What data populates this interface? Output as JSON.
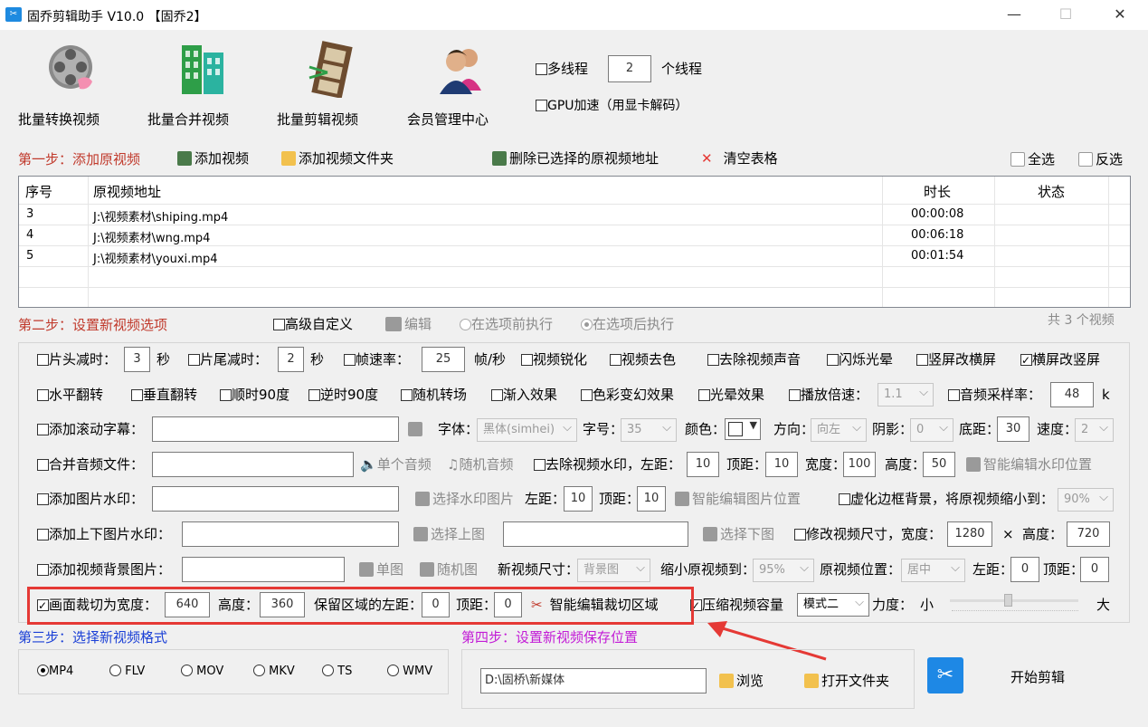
{
  "window": {
    "title": "固乔剪辑助手 V10.0 【固乔2】",
    "min_glyph": "—",
    "max_glyph": "☐",
    "close_glyph": "✕"
  },
  "toolbar": {
    "batch_convert": "批量转换视频",
    "batch_merge": "批量合并视频",
    "batch_edit": "批量剪辑视频",
    "member_center": "会员管理中心",
    "multithread_label": "多线程",
    "threads_value": "2",
    "threads_unit": "个线程",
    "gpu_label": "GPU加速（用显卡解码）"
  },
  "step1": {
    "label": "第一步：添加原视频",
    "add_video": "添加视频",
    "add_folder": "添加视频文件夹",
    "delete_selected": "删除已选择的原视频地址",
    "clear_table": "清空表格",
    "select_all": "全选",
    "invert": "反选"
  },
  "table": {
    "headers": [
      "序号",
      "原视频地址",
      "时长",
      "状态"
    ],
    "rows": [
      {
        "no": "3",
        "path": "J:\\视频素材\\shiping.mp4",
        "duration": "00:00:08",
        "status": ""
      },
      {
        "no": "4",
        "path": "J:\\视频素材\\wng.mp4",
        "duration": "00:06:18",
        "status": ""
      },
      {
        "no": "5",
        "path": "J:\\视频素材\\youxi.mp4",
        "duration": "00:01:54",
        "status": ""
      }
    ]
  },
  "step2": {
    "label": "第二步：设置新视频选项",
    "advanced": "高级自定义",
    "edit": "编辑",
    "before": "在选项前执行",
    "after": "在选项后执行",
    "total": "共 3 个视频"
  },
  "opts": {
    "r1": {
      "head_cut": "片头减时：",
      "head_val": "3",
      "sec1": "秒",
      "tail_cut": "片尾减时：",
      "tail_val": "2",
      "sec2": "秒",
      "fps": "帧速率：",
      "fps_val": "25",
      "fps_unit": "帧/秒",
      "sharpen": "视频锐化",
      "decolor": "视频去色",
      "mute": "去除视频声音",
      "flash": "闪烁光晕",
      "v2h": "竖屏改横屏",
      "h2v": "横屏改竖屏"
    },
    "r2": {
      "hflip": "水平翻转",
      "vflip": "垂直翻转",
      "cw90": "顺时90度",
      "ccw90": "逆时90度",
      "random_trans": "随机转场",
      "fade": "渐入效果",
      "color_fx": "色彩变幻效果",
      "halo": "光晕效果",
      "speed": "播放倍速：",
      "speed_val": "1.1",
      "sample": "音频采样率：",
      "sample_val": "48",
      "sample_unit": "k"
    },
    "r3": {
      "scroll": "添加滚动字幕：",
      "font": "字体：",
      "font_val": "黑体(simhei)",
      "size": "字号：",
      "size_val": "35",
      "color": "颜色：",
      "dir": "方向：",
      "dir_val": "向左",
      "shadow": "阴影：",
      "shadow_val": "0",
      "bottom": "底距：",
      "bottom_val": "30",
      "spd": "速度：",
      "spd_val": "2"
    },
    "r4": {
      "merge_audio": "合并音频文件：",
      "single_audio": "单个音频",
      "random_audio": "随机音频",
      "remove_wm": "去除视频水印，左距：",
      "left_val": "10",
      "top": "顶距：",
      "top_val": "10",
      "width": "宽度：",
      "width_val": "100",
      "height": "高度：",
      "height_val": "50",
      "smart_wm": "智能编辑水印位置"
    },
    "r5": {
      "img_wm": "添加图片水印：",
      "select_wm": "选择水印图片",
      "left": "左距：",
      "left_val": "10",
      "top": "顶距：",
      "top_val": "10",
      "smart_img": "智能编辑图片位置",
      "blur_bg": "虚化边框背景，将原视频缩小到：",
      "blur_val": "90%"
    },
    "r6": {
      "tb_wm": "添加上下图片水印：",
      "select_top": "选择上图",
      "select_bottom": "选择下图",
      "resize": "修改视频尺寸，宽度：",
      "resize_w": "1280",
      "times": "×",
      "resize_h_label": "高度：",
      "resize_h": "720"
    },
    "r7": {
      "bg_img": "添加视频背景图片：",
      "single": "单图",
      "random": "随机图",
      "new_size": "新视频尺寸：",
      "new_size_val": "背景图",
      "shrink": "缩小原视频到：",
      "shrink_val": "95%",
      "pos": "原视频位置：",
      "pos_val": "居中",
      "left": "左距：",
      "left_val": "0",
      "top": "顶距：",
      "top_val": "0"
    },
    "r8": {
      "crop": "画面裁切为宽度：",
      "crop_w": "640",
      "height": "高度：",
      "crop_h": "360",
      "keep_left": "保留区域的左距：",
      "keep_left_val": "0",
      "top": "顶距：",
      "top_val": "0",
      "smart_crop": "智能编辑裁切区域",
      "compress": "压缩视频容量",
      "mode_val": "模式二",
      "force": "力度：",
      "small": "小",
      "large": "大",
      "force_level": 0.45
    }
  },
  "step3": {
    "label": "第三步：选择新视频格式",
    "formats": [
      "MP4",
      "FLV",
      "MOV",
      "MKV",
      "TS",
      "WMV"
    ]
  },
  "step4": {
    "label": "第四步：设置新视频保存位置",
    "path": "D:\\固桥\\新媒体",
    "browse": "浏览",
    "open_folder": "打开文件夹",
    "start": "开始剪辑"
  },
  "colors": {
    "step_red": "#c0392b",
    "step_blue": "#1a3fd6",
    "step_magenta": "#c21bd6",
    "highlight": "#e53935"
  }
}
